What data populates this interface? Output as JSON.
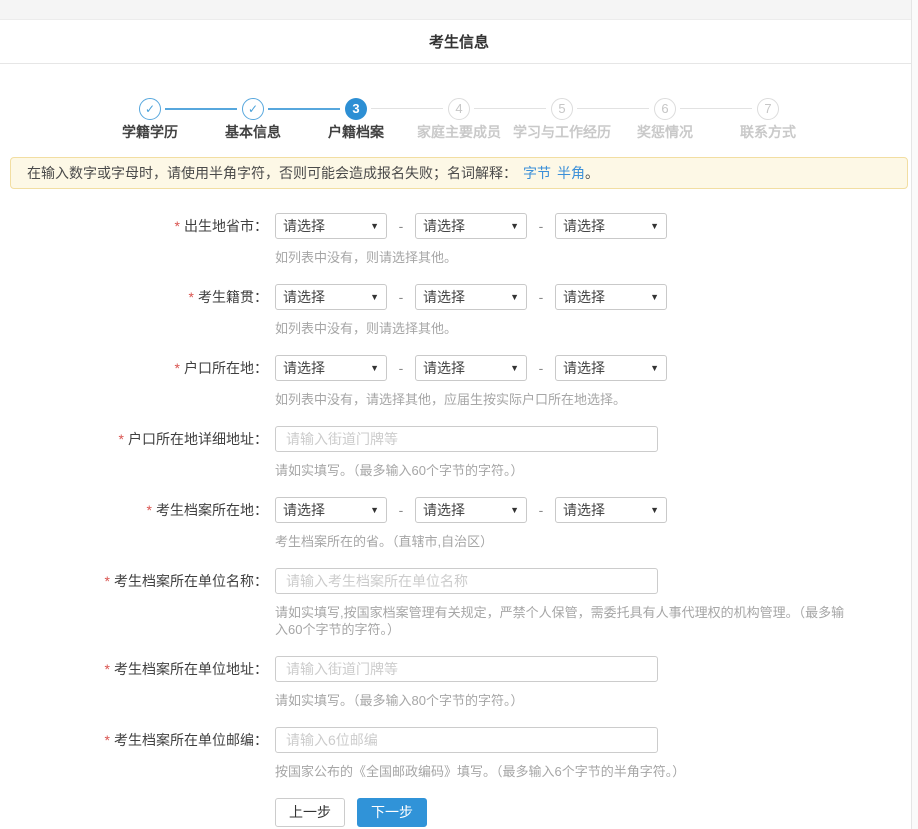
{
  "header": {
    "title": "考生信息"
  },
  "stepper": {
    "check_icon_glyph": "✓",
    "steps": [
      {
        "number": "1",
        "label": "学籍学历",
        "state": "completed"
      },
      {
        "number": "2",
        "label": "基本信息",
        "state": "completed"
      },
      {
        "number": "3",
        "label": "户籍档案",
        "state": "active"
      },
      {
        "number": "4",
        "label": "家庭主要成员",
        "state": "upcoming"
      },
      {
        "number": "5",
        "label": "学习与工作经历",
        "state": "upcoming"
      },
      {
        "number": "6",
        "label": "奖惩情况",
        "state": "upcoming"
      },
      {
        "number": "7",
        "label": "联系方式",
        "state": "upcoming"
      }
    ]
  },
  "notice": {
    "text": "在输入数字或字母时，请使用半角字符，否则可能会造成报名失败；名词解释：",
    "links": [
      "字节",
      "半角"
    ],
    "suffix": "。"
  },
  "form": {
    "required_marker": "*",
    "select_placeholder": "请选择",
    "select_separator": "-",
    "rows": [
      {
        "id": "birthplace",
        "label": "出生地省市：",
        "type": "select3",
        "help": "如列表中没有，则请选择其他。"
      },
      {
        "id": "native-place",
        "label": "考生籍贯：",
        "type": "select3",
        "help": "如列表中没有，则请选择其他。"
      },
      {
        "id": "household-location",
        "label": "户口所在地：",
        "type": "select3",
        "help": "如列表中没有，请选择其他，应届生按实际户口所在地选择。"
      },
      {
        "id": "household-address",
        "label": "户口所在地详细地址：",
        "type": "text",
        "value": "",
        "placeholder": "请输入街道门牌等",
        "help": "请如实填写。（最多输入60个字节的字符。）"
      },
      {
        "id": "archive-location",
        "label": "考生档案所在地：",
        "type": "select3",
        "help": "考生档案所在的省。（直辖市,自治区）"
      },
      {
        "id": "archive-unit-name",
        "label": "考生档案所在单位名称：",
        "type": "text",
        "value": "",
        "placeholder": "请输入考生档案所在单位名称",
        "help": "请如实填写,按国家档案管理有关规定，严禁个人保管，需委托具有人事代理权的机构管理。（最多输入60个字节的字符。）"
      },
      {
        "id": "archive-unit-address",
        "label": "考生档案所在单位地址：",
        "type": "text",
        "value": "",
        "placeholder": "请输入街道门牌等",
        "help": "请如实填写。（最多输入80个字节的字符。）"
      },
      {
        "id": "archive-unit-postcode",
        "label": "考生档案所在单位邮编：",
        "type": "text",
        "value": "",
        "placeholder": "请输入6位邮编",
        "help": "按国家公布的《全国邮政编码》填写。（最多输入6个字节的半角字符。）"
      }
    ],
    "buttons": {
      "prev": "上一步",
      "next": "下一步"
    }
  },
  "colors": {
    "accent_blue": "#2d8fd4",
    "step_line_blue": "#57a7dd",
    "notice_bg": "#fdf8e6",
    "notice_border": "#f2dea2",
    "link_blue": "#3a8fd8",
    "required_red": "#d9534f"
  }
}
